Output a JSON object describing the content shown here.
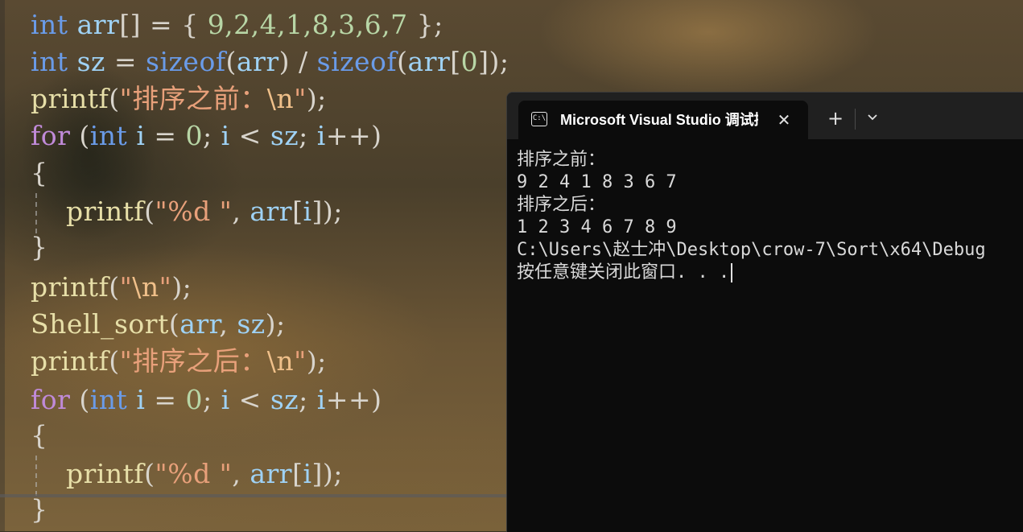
{
  "editor": {
    "lines": [
      {
        "parts": [
          [
            "kw",
            "int"
          ],
          [
            "pun",
            " "
          ],
          [
            "id",
            "arr"
          ],
          [
            "pun",
            "[] = { "
          ],
          [
            "num",
            "9,2,4,1,8,3,6,7"
          ],
          [
            "pun",
            " };"
          ]
        ]
      },
      {
        "parts": [
          [
            "kw",
            "int"
          ],
          [
            "pun",
            " "
          ],
          [
            "id",
            "sz"
          ],
          [
            "pun",
            " = "
          ],
          [
            "kw",
            "sizeof"
          ],
          [
            "pun",
            "("
          ],
          [
            "id",
            "arr"
          ],
          [
            "pun",
            ") / "
          ],
          [
            "kw",
            "sizeof"
          ],
          [
            "pun",
            "("
          ],
          [
            "id",
            "arr"
          ],
          [
            "pun",
            "["
          ],
          [
            "num",
            "0"
          ],
          [
            "pun",
            "]);"
          ]
        ]
      },
      {
        "parts": [
          [
            "fn",
            "printf"
          ],
          [
            "pun",
            "("
          ],
          [
            "str",
            "\"排序之前："
          ],
          [
            "esc",
            "\\n"
          ],
          [
            "str",
            "\""
          ],
          [
            "pun",
            ");"
          ]
        ]
      },
      {
        "parts": [
          [
            "ctl",
            "for"
          ],
          [
            "pun",
            " ("
          ],
          [
            "kw",
            "int"
          ],
          [
            "pun",
            " "
          ],
          [
            "id",
            "i"
          ],
          [
            "pun",
            " = "
          ],
          [
            "num",
            "0"
          ],
          [
            "pun",
            "; "
          ],
          [
            "id",
            "i"
          ],
          [
            "pun",
            " < "
          ],
          [
            "id",
            "sz"
          ],
          [
            "pun",
            "; "
          ],
          [
            "id",
            "i"
          ],
          [
            "pun",
            "++)"
          ]
        ]
      },
      {
        "parts": [
          [
            "pun",
            "{"
          ]
        ]
      },
      {
        "parts": [
          [
            "pun",
            "    "
          ],
          [
            "fn",
            "printf"
          ],
          [
            "pun",
            "("
          ],
          [
            "str",
            "\"%d \""
          ],
          [
            "pun",
            ", "
          ],
          [
            "id",
            "arr"
          ],
          [
            "pun",
            "["
          ],
          [
            "id",
            "i"
          ],
          [
            "pun",
            "]);"
          ]
        ]
      },
      {
        "parts": [
          [
            "pun",
            "}"
          ]
        ]
      },
      {
        "parts": [
          [
            "fn",
            "printf"
          ],
          [
            "pun",
            "("
          ],
          [
            "str",
            "\""
          ],
          [
            "esc",
            "\\n"
          ],
          [
            "str",
            "\""
          ],
          [
            "pun",
            ");"
          ]
        ]
      },
      {
        "parts": [
          [
            "fn",
            "Shell_sort"
          ],
          [
            "pun",
            "("
          ],
          [
            "id",
            "arr"
          ],
          [
            "pun",
            ", "
          ],
          [
            "id",
            "sz"
          ],
          [
            "pun",
            ");"
          ]
        ]
      },
      {
        "parts": [
          [
            "fn",
            "printf"
          ],
          [
            "pun",
            "("
          ],
          [
            "str",
            "\"排序之后："
          ],
          [
            "esc",
            "\\n"
          ],
          [
            "str",
            "\""
          ],
          [
            "pun",
            ");"
          ]
        ]
      },
      {
        "parts": [
          [
            "ctl",
            "for"
          ],
          [
            "pun",
            " ("
          ],
          [
            "kw",
            "int"
          ],
          [
            "pun",
            " "
          ],
          [
            "id",
            "i"
          ],
          [
            "pun",
            " = "
          ],
          [
            "num",
            "0"
          ],
          [
            "pun",
            "; "
          ],
          [
            "id",
            "i"
          ],
          [
            "pun",
            " < "
          ],
          [
            "id",
            "sz"
          ],
          [
            "pun",
            "; "
          ],
          [
            "id",
            "i"
          ],
          [
            "pun",
            "++)"
          ]
        ]
      },
      {
        "parts": [
          [
            "pun",
            "{"
          ]
        ]
      },
      {
        "parts": [
          [
            "pun",
            "    "
          ],
          [
            "fn",
            "printf"
          ],
          [
            "pun",
            "("
          ],
          [
            "str",
            "\"%d \""
          ],
          [
            "pun",
            ", "
          ],
          [
            "id",
            "arr"
          ],
          [
            "pun",
            "["
          ],
          [
            "id",
            "i"
          ],
          [
            "pun",
            "]);"
          ]
        ]
      },
      {
        "parts": [
          [
            "pun",
            "}"
          ]
        ]
      }
    ]
  },
  "terminal": {
    "tab_title": "Microsoft Visual Studio 调试控制台",
    "tab_icon": "terminal-icon",
    "close_glyph": "✕",
    "new_tab_glyph": "+",
    "dropdown_icon": "chevron-down-icon",
    "output": [
      "排序之前：",
      "9 2 4 1 8 3 6 7",
      "排序之后：",
      "1 2 3 4 6 7 8 9",
      "C:\\Users\\赵士冲\\Desktop\\crow-7\\Sort\\x64\\Debug",
      "按任意键关闭此窗口. . ."
    ]
  },
  "colors": {
    "keyword": "#6a9be8",
    "control": "#c08ad8",
    "function": "#e7dfa8",
    "string": "#e8a07a",
    "number": "#b8d6a6",
    "identifier": "#9fd2f5",
    "terminal_bg": "#0c0c0c",
    "tabstrip_bg": "#202020"
  }
}
